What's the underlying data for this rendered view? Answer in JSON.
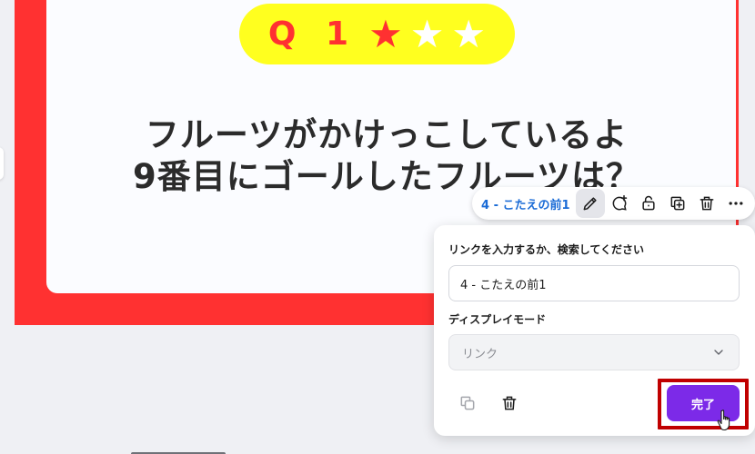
{
  "slide": {
    "question_label": "Q 1",
    "stars": {
      "filled": 1,
      "total": 3
    },
    "question_text": "フルーツがかけっこしているよ\n9番目にゴールしたフルーツは？",
    "frame_color": "#ff3131",
    "pill_color": "#ffff1f"
  },
  "link_toolbar": {
    "link_chip": "4 - こたえの前1",
    "icons": [
      "pencil-icon",
      "comment-add-icon",
      "lock-icon",
      "duplicate-icon",
      "trash-icon",
      "more-icon"
    ]
  },
  "link_panel": {
    "input_label": "リンクを入力するか、検索してください",
    "input_value": "4 - こたえの前1",
    "display_mode_label": "ディスプレイモード",
    "display_mode_value": "リンク",
    "done_label": "完了",
    "accent_color": "#7c2ae8"
  }
}
